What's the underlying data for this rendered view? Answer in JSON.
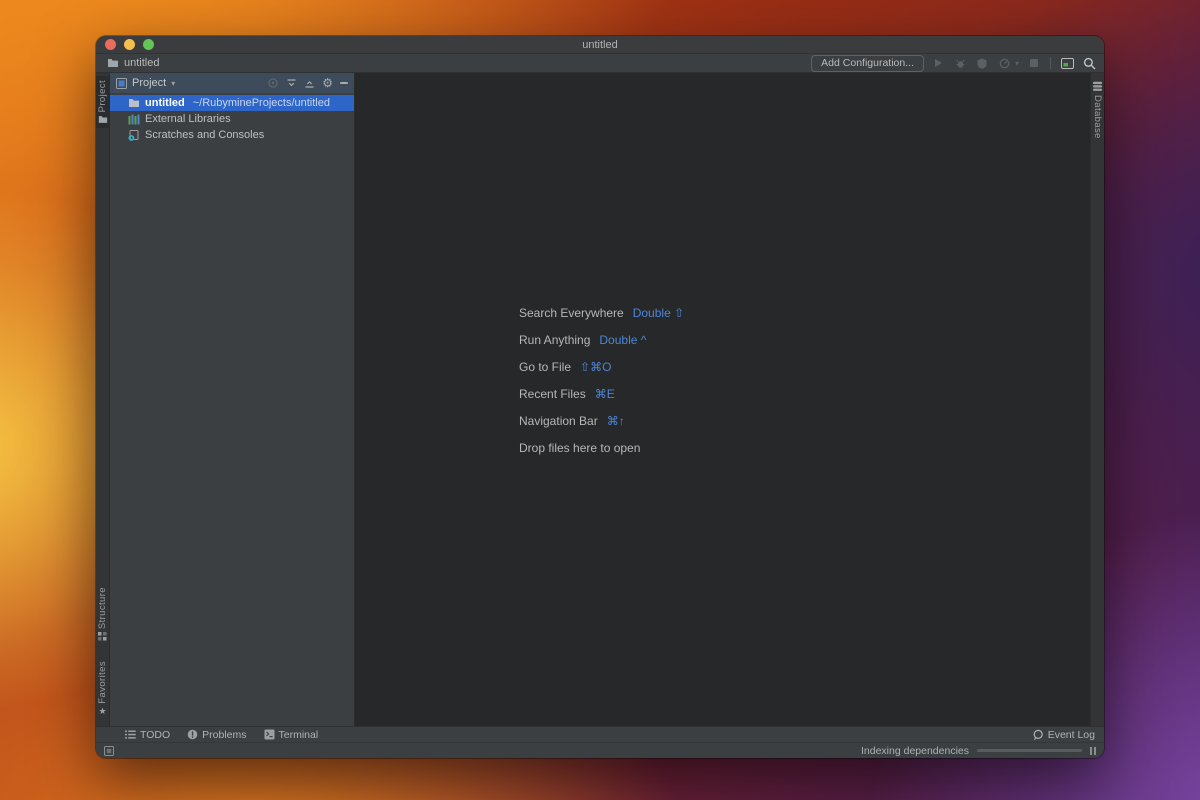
{
  "window": {
    "title": "untitled"
  },
  "toolbar": {
    "breadcrumb": "untitled",
    "add_configuration": "Add Configuration..."
  },
  "stripes": {
    "project": "Project",
    "structure": "Structure",
    "favorites": "Favorites",
    "database": "Database"
  },
  "project_panel": {
    "title": "Project",
    "tree": [
      {
        "name": "untitled",
        "path": "~/RubymineProjects/untitled"
      },
      {
        "name": "External Libraries"
      },
      {
        "name": "Scratches and Consoles"
      }
    ]
  },
  "editor": {
    "shortcuts": [
      {
        "label": "Search Everywhere",
        "keys": "Double ⇧"
      },
      {
        "label": "Run Anything",
        "keys": "Double ^"
      },
      {
        "label": "Go to File",
        "keys": "⇧⌘O"
      },
      {
        "label": "Recent Files",
        "keys": "⌘E"
      },
      {
        "label": "Navigation Bar",
        "keys": "⌘↑"
      },
      {
        "label": "Drop files here to open",
        "keys": ""
      }
    ]
  },
  "bottom_bar": {
    "todo": "TODO",
    "problems": "Problems",
    "terminal": "Terminal",
    "event_log": "Event Log"
  },
  "status_bar": {
    "task": "Indexing dependencies",
    "progress_width": "58%"
  },
  "glyphs": {
    "caret_down": "▾",
    "gear": "⚙",
    "star": "★"
  },
  "colors": {
    "selection_blue": "#2e65c9",
    "shortcut_blue": "#4e86d9",
    "panel_header_blue": "#3d4b5a",
    "editor_bg": "#272829",
    "panel_bg": "#3c3f41",
    "traffic_red": "#ed6a5e",
    "traffic_yellow": "#f5bf4f",
    "traffic_green": "#62c554"
  }
}
